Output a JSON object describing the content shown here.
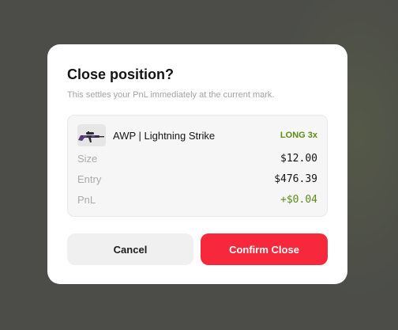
{
  "modal": {
    "title": "Close position?",
    "subtitle": "This settles your PnL immediately at the current mark."
  },
  "position": {
    "item_name": "AWP | Lightning Strike",
    "item_icon": "awp-rifle-icon",
    "side_badge": "LONG 3x",
    "rows": [
      {
        "label": "Size",
        "value": "$12.00",
        "tone": "neutral"
      },
      {
        "label": "Entry",
        "value": "$476.39",
        "tone": "neutral"
      },
      {
        "label": "PnL",
        "value": "+$0.04",
        "tone": "positive"
      }
    ]
  },
  "actions": {
    "cancel_label": "Cancel",
    "confirm_label": "Confirm Close"
  },
  "colors": {
    "backdrop": "#4c4d49",
    "positive": "#5e8a16",
    "danger": "#f7283b",
    "cancel_bg": "#f0f0f0"
  }
}
